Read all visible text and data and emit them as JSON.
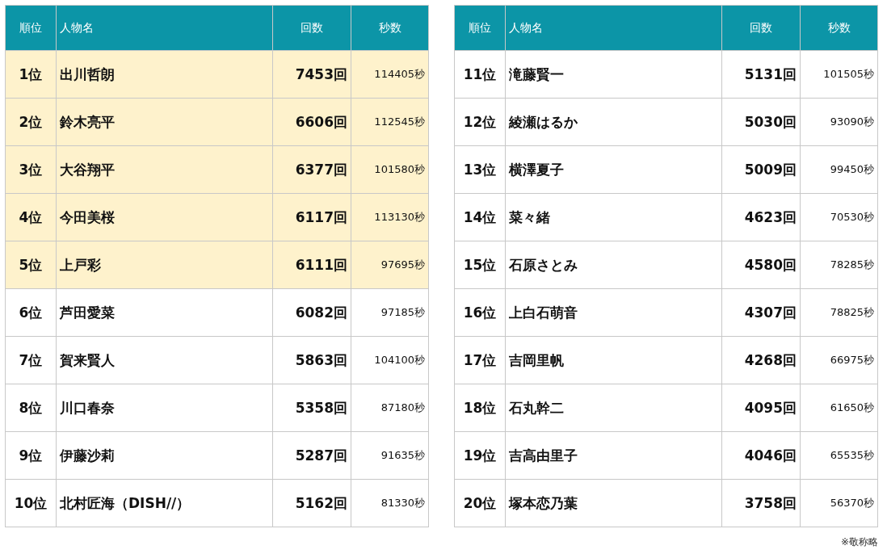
{
  "tables": [
    {
      "columns": [
        "順位",
        "人物名",
        "回数",
        "秒数"
      ],
      "rows": [
        {
          "rank": "1位",
          "name": "出川哲朗",
          "count": "7453回",
          "seconds": "114405秒",
          "highlighted": true
        },
        {
          "rank": "2位",
          "name": "鈴木亮平",
          "count": "6606回",
          "seconds": "112545秒",
          "highlighted": true
        },
        {
          "rank": "3位",
          "name": "大谷翔平",
          "count": "6377回",
          "seconds": "101580秒",
          "highlighted": true
        },
        {
          "rank": "4位",
          "name": "今田美桜",
          "count": "6117回",
          "seconds": "113130秒",
          "highlighted": true
        },
        {
          "rank": "5位",
          "name": "上戸彩",
          "count": "6111回",
          "seconds": "97695秒",
          "highlighted": true
        },
        {
          "rank": "6位",
          "name": "芦田愛菜",
          "count": "6082回",
          "seconds": "97185秒",
          "highlighted": false
        },
        {
          "rank": "7位",
          "name": "賀来賢人",
          "count": "5863回",
          "seconds": "104100秒",
          "highlighted": false
        },
        {
          "rank": "8位",
          "name": "川口春奈",
          "count": "5358回",
          "seconds": "87180秒",
          "highlighted": false
        },
        {
          "rank": "9位",
          "name": "伊藤沙莉",
          "count": "5287回",
          "seconds": "91635秒",
          "highlighted": false
        },
        {
          "rank": "10位",
          "name": "北村匠海（DISH//）",
          "count": "5162回",
          "seconds": "81330秒",
          "highlighted": false
        }
      ]
    },
    {
      "columns": [
        "順位",
        "人物名",
        "回数",
        "秒数"
      ],
      "rows": [
        {
          "rank": "11位",
          "name": "滝藤賢一",
          "count": "5131回",
          "seconds": "101505秒",
          "highlighted": false
        },
        {
          "rank": "12位",
          "name": "綾瀬はるか",
          "count": "5030回",
          "seconds": "93090秒",
          "highlighted": false
        },
        {
          "rank": "13位",
          "name": "横澤夏子",
          "count": "5009回",
          "seconds": "99450秒",
          "highlighted": false
        },
        {
          "rank": "14位",
          "name": "菜々緒",
          "count": "4623回",
          "seconds": "70530秒",
          "highlighted": false
        },
        {
          "rank": "15位",
          "name": "石原さとみ",
          "count": "4580回",
          "seconds": "78285秒",
          "highlighted": false
        },
        {
          "rank": "16位",
          "name": "上白石萌音",
          "count": "4307回",
          "seconds": "78825秒",
          "highlighted": false
        },
        {
          "rank": "17位",
          "name": "吉岡里帆",
          "count": "4268回",
          "seconds": "66975秒",
          "highlighted": false
        },
        {
          "rank": "18位",
          "name": "石丸幹二",
          "count": "4095回",
          "seconds": "61650秒",
          "highlighted": false
        },
        {
          "rank": "19位",
          "name": "吉高由里子",
          "count": "4046回",
          "seconds": "65535秒",
          "highlighted": false
        },
        {
          "rank": "20位",
          "name": "塚本恋乃葉",
          "count": "3758回",
          "seconds": "56370秒",
          "highlighted": false
        }
      ]
    }
  ],
  "note": "※敬称略"
}
